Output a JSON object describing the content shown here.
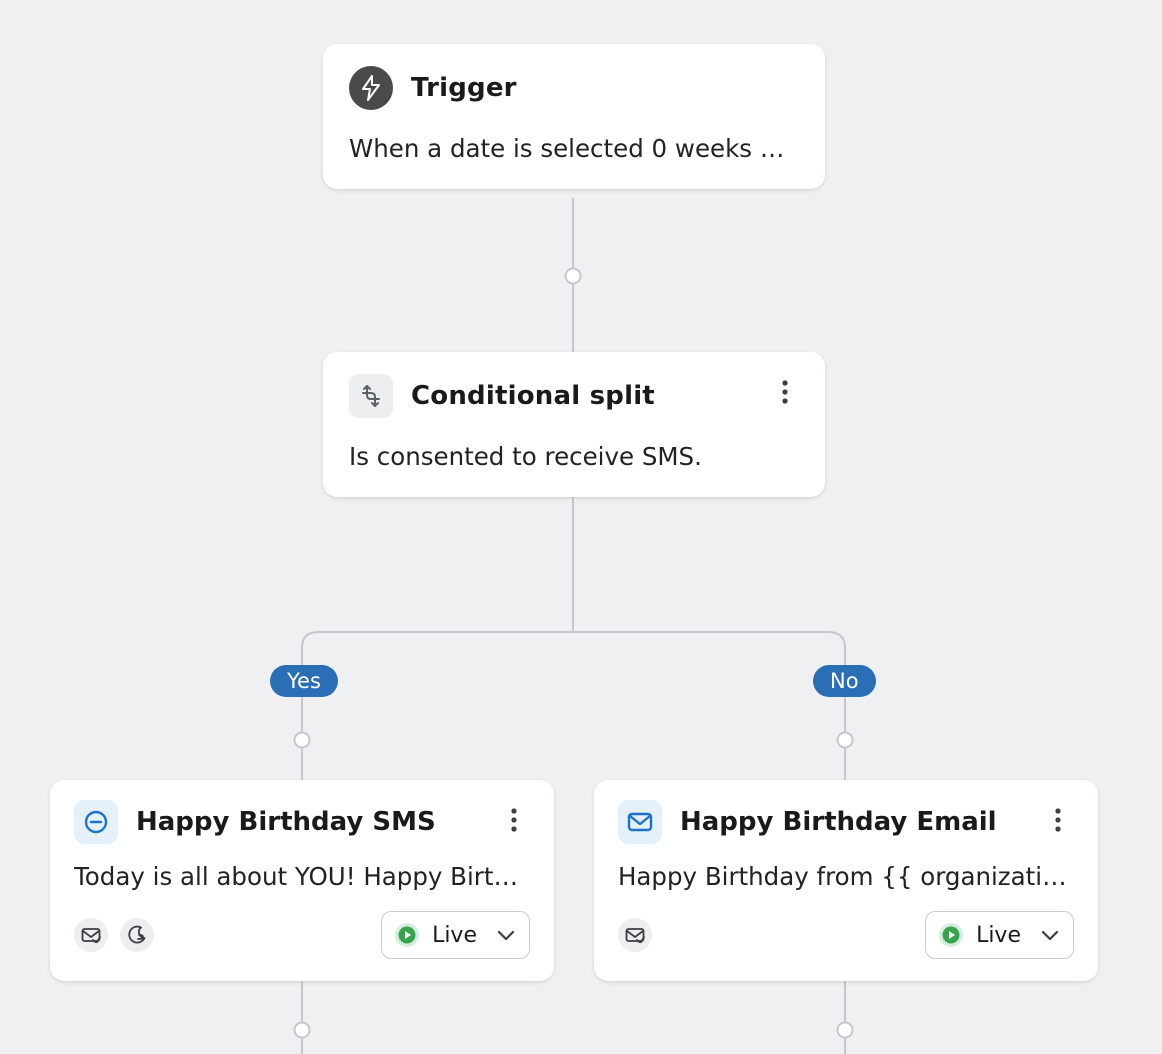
{
  "colors": {
    "branch_pill": "#2a6fb6",
    "icon_dark_bg": "#4a4a4a",
    "icon_light_bg": "#eceeef",
    "icon_channel_bg": "#e4f1fb",
    "icon_channel_stroke": "#1a73c8",
    "live_green": "#35a44a",
    "live_halo": "#d4eedd"
  },
  "trigger": {
    "title": "Trigger",
    "description": "When a date is selected 0 weeks before ..."
  },
  "split": {
    "title": "Conditional split",
    "description": "Is consented to receive SMS.",
    "branches": {
      "left": "Yes",
      "right": "No"
    }
  },
  "cards": {
    "left": {
      "title": "Happy Birthday SMS",
      "description": "Today is all about YOU! Happy Birthday fr...",
      "status": "Live",
      "footer_icons": [
        "smart-send-icon",
        "quiet-hours-icon"
      ]
    },
    "right": {
      "title": "Happy Birthday Email",
      "description": "Happy Birthday from {{ organization.nam...",
      "status": "Live",
      "footer_icons": [
        "smart-send-icon"
      ]
    }
  }
}
